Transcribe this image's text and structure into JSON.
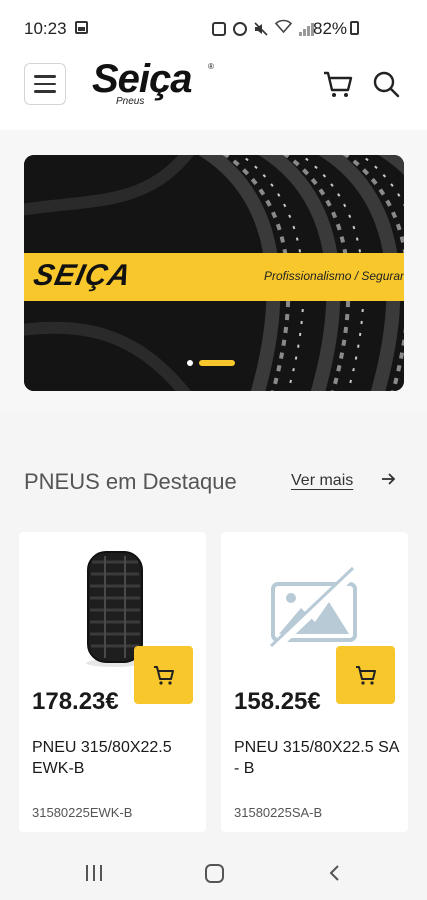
{
  "status_bar": {
    "time": "10:23",
    "battery": "82%"
  },
  "header": {
    "logo_text": "Seiça",
    "logo_sub": "Pneus"
  },
  "banner": {
    "brand": "SEIÇA",
    "tagline": "Profissionalismo / Segurança",
    "slide_count": 2,
    "active_slide": 2
  },
  "section": {
    "title": "PNEUS em Destaque",
    "see_more": "Ver mais"
  },
  "products": [
    {
      "price": "178.23€",
      "name": "PNEU 315/80X22.5 EWK-B",
      "code": "31580225EWK-B",
      "image": "tire-photo"
    },
    {
      "price": "158.25€",
      "name": "PNEU 315/80X22.5 SA - B",
      "code": "31580225SA-B",
      "image": "image-placeholder-icon"
    }
  ],
  "colors": {
    "accent": "#f7c72b",
    "background": "#f5f5f5"
  }
}
